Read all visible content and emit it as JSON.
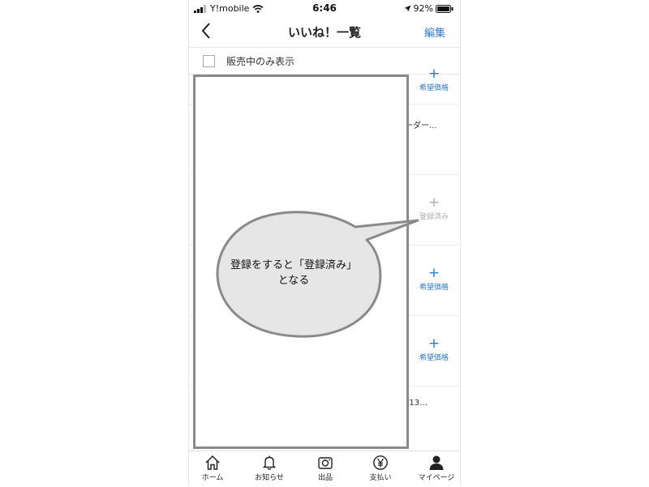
{
  "status_bar": {
    "carrier": "Y!mobile",
    "time": "6:46",
    "battery": "92%"
  },
  "nav": {
    "title": "いいね！一覧",
    "edit_label": "編集"
  },
  "filter": {
    "label": "販売中のみ表示"
  },
  "list": {
    "row_texts": [
      "ーダー...",
      "/13…"
    ],
    "actions": [
      {
        "label": "希望価格",
        "state": "cutoff"
      },
      {
        "label": "登録済み",
        "state": "registered"
      },
      {
        "label": "希望価格",
        "state": "active"
      },
      {
        "label": "希望価格",
        "state": "active"
      }
    ]
  },
  "callout": {
    "line1": "登録をすると「登録済み」",
    "line2": "となる"
  },
  "tabs": [
    {
      "label": "ホーム",
      "icon": "home-icon"
    },
    {
      "label": "お知らせ",
      "icon": "bell-icon"
    },
    {
      "label": "出品",
      "icon": "camera-icon"
    },
    {
      "label": "支払い",
      "icon": "yen-icon"
    },
    {
      "label": "マイページ",
      "icon": "person-icon"
    }
  ],
  "colors": {
    "accent": "#2f7bd3",
    "disabled": "#b0b0b0",
    "frame": "#8a8a8a",
    "bubble_fill": "#e6e6e6"
  }
}
